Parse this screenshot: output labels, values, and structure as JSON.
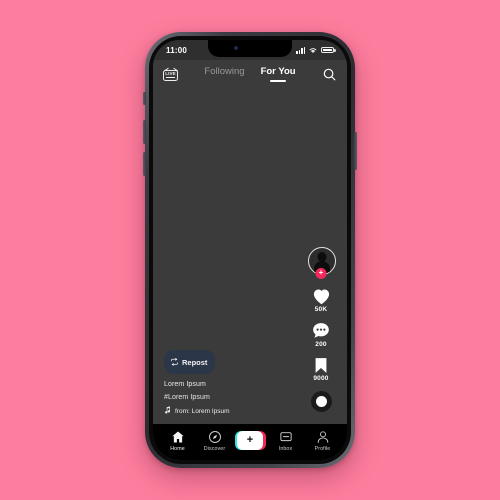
{
  "background": {
    "color": "#fd7d9e"
  },
  "device": {
    "frame_name": "smartphone-mockup",
    "buttons": [
      "silence-switch",
      "volume-up",
      "volume-down",
      "power"
    ]
  },
  "status_bar": {
    "time": "11:00",
    "icons": [
      "cellular-signal-icon",
      "wifi-icon",
      "battery-icon"
    ]
  },
  "top_nav": {
    "live_icon_label": "LIVE",
    "tabs": [
      {
        "label": "Following",
        "active": false
      },
      {
        "label": "For You",
        "active": true
      }
    ],
    "search_icon": "search-icon"
  },
  "action_rail": {
    "avatar": {
      "icon": "user-avatar-icon",
      "follow_badge": "+"
    },
    "items": [
      {
        "icon": "heart-icon",
        "count": "50K"
      },
      {
        "icon": "comment-icon",
        "count": "200"
      },
      {
        "icon": "bookmark-icon",
        "count": "9000"
      }
    ],
    "music_disc": "music-disc-icon"
  },
  "caption": {
    "repost": {
      "icon": "repost-icon",
      "label": "Repost"
    },
    "username": "Lorem Ipsum",
    "hashtag": "#Lorem Ipsum",
    "music_icon": "music-note-icon",
    "music_text": "from: Lorem Ipsum"
  },
  "tab_bar": {
    "tabs": [
      {
        "label": "Home",
        "icon": "home-icon"
      },
      {
        "label": "Discover",
        "icon": "compass-icon"
      },
      {
        "label": "Inbox",
        "icon": "inbox-icon"
      },
      {
        "label": "Profile",
        "icon": "person-icon"
      }
    ],
    "create": {
      "icon": "plus-icon",
      "glyph": "+"
    }
  },
  "colors": {
    "background_pink": "#fd7d9e",
    "screen_dark": "#3b3b3b",
    "tabbar_black": "#000000",
    "accent_red": "#f3285c",
    "accent_cyan": "#24e7e0",
    "repost_pill": "#2b3648"
  }
}
